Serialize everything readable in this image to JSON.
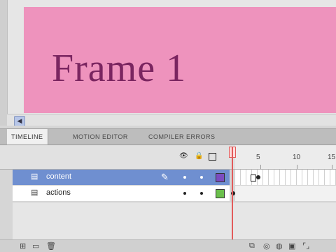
{
  "stage": {
    "text": "Frame 1",
    "background": "#ee93bd",
    "text_color": "#7a2560"
  },
  "tabs": [
    {
      "label": "TIMELINE",
      "active": true
    },
    {
      "label": "MOTION EDITOR",
      "active": false
    },
    {
      "label": "COMPILER ERRORS",
      "active": false
    }
  ],
  "header_icons": [
    "eye-icon",
    "lock-icon",
    "outline-icon"
  ],
  "ruler": {
    "numbers": [
      "1",
      "5",
      "10",
      "15"
    ]
  },
  "layers": [
    {
      "name": "content",
      "selected": true,
      "outline_color": "#7b4cc0"
    },
    {
      "name": "actions",
      "selected": false,
      "outline_color": "#6bbf4c"
    }
  ],
  "playhead_color": "#e25b5b",
  "footer_icons": [
    "new-layer-icon",
    "new-folder-icon",
    "delete-layer-icon",
    "onion-skin-icon",
    "edit-multiple-frames-icon"
  ]
}
